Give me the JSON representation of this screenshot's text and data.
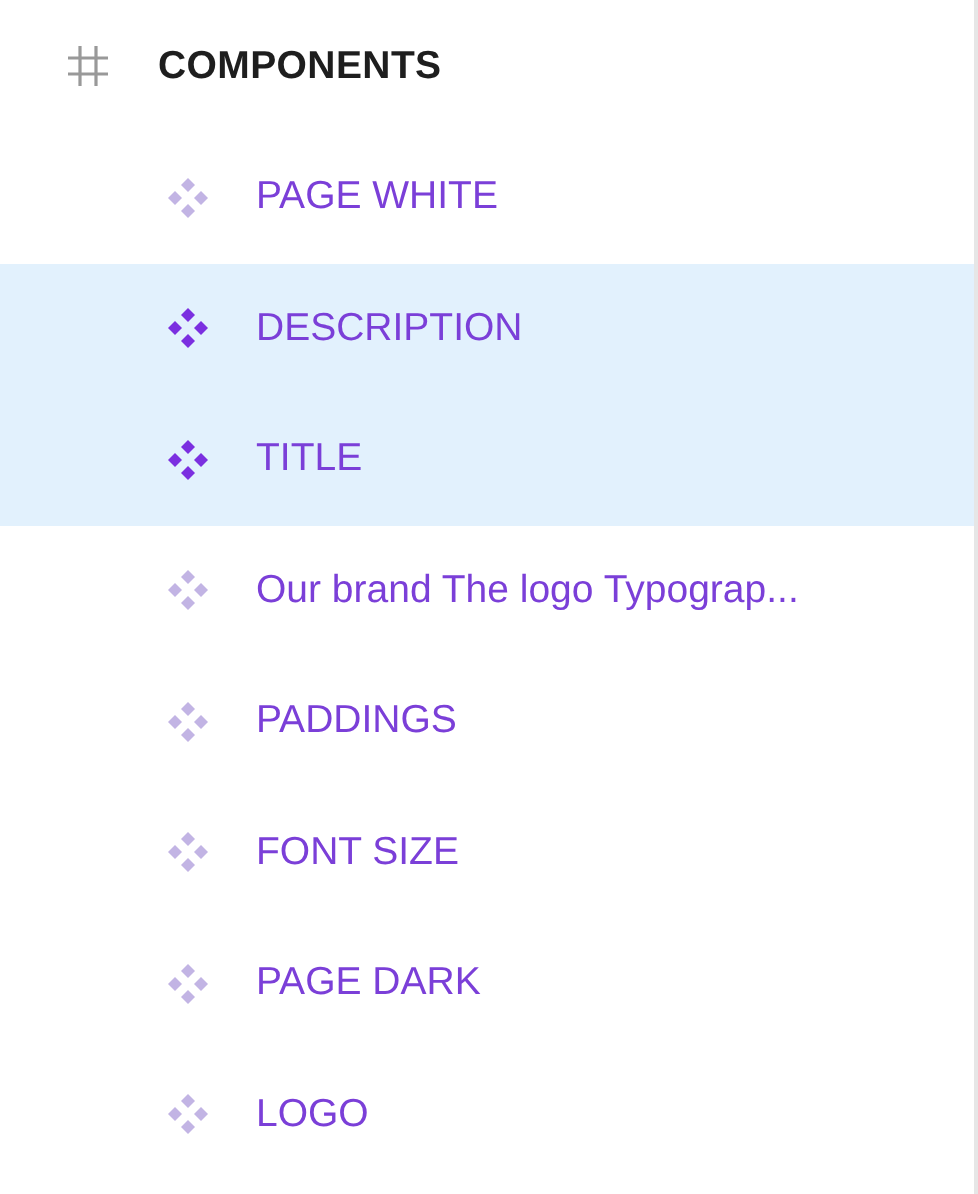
{
  "frame": {
    "name": "COMPONENTS"
  },
  "layers": [
    {
      "name": "PAGE WHITE",
      "selected": false
    },
    {
      "name": "DESCRIPTION",
      "selected": true
    },
    {
      "name": "TITLE",
      "selected": true
    },
    {
      "name": "Our brand The logo Typograp...",
      "selected": false
    },
    {
      "name": "PADDINGS",
      "selected": false
    },
    {
      "name": "FONT SIZE",
      "selected": false
    },
    {
      "name": "PAGE DARK",
      "selected": false
    },
    {
      "name": "LOGO",
      "selected": false
    }
  ]
}
